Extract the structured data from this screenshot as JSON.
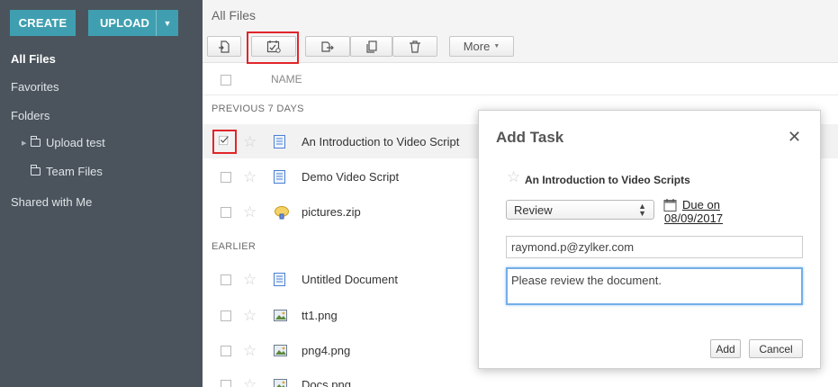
{
  "sidebar": {
    "create_label": "CREATE",
    "upload_label": "UPLOAD",
    "nav": {
      "all_files": "All Files",
      "favorites": "Favorites",
      "folders": "Folders",
      "shared": "Shared with Me"
    },
    "folders": [
      "Upload test",
      "Team Files"
    ]
  },
  "main": {
    "title": "All Files",
    "toolbar": {
      "more_label": "More"
    },
    "column_name": "NAME",
    "sections": {
      "recent": "PREVIOUS 7 DAYS",
      "earlier": "EARLIER"
    },
    "files_recent": [
      {
        "name": "An Introduction to Video Script",
        "icon": "document-icon",
        "selected": true
      },
      {
        "name": "Demo Video Script",
        "icon": "document-icon",
        "selected": false
      },
      {
        "name": "pictures.zip",
        "icon": "zip-icon",
        "selected": false
      }
    ],
    "files_earlier": [
      {
        "name": "Untitled Document",
        "icon": "document-icon"
      },
      {
        "name": "tt1.png",
        "icon": "image-icon"
      },
      {
        "name": "png4.png",
        "icon": "image-icon"
      },
      {
        "name": "Docs.png",
        "icon": "image-icon"
      }
    ]
  },
  "modal": {
    "title": "Add Task",
    "file_name": "An Introduction to Video Scripts",
    "status_value": "Review",
    "due_label": "Due on",
    "due_date": "08/09/2017",
    "email_value": "raymond.p@zylker.com",
    "note_value": "Please review the document.",
    "add_label": "Add",
    "cancel_label": "Cancel"
  },
  "colors": {
    "sidebar_bg": "#4b545c",
    "accent": "#3f9fb0",
    "highlight": "#e0262b",
    "focus_border": "#73aee8"
  }
}
